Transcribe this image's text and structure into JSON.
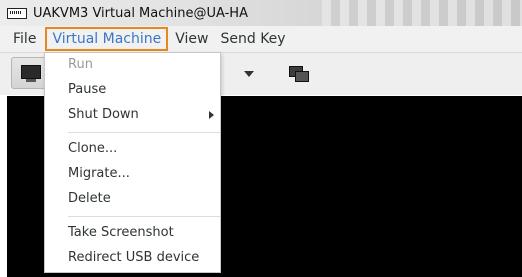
{
  "window": {
    "title": "UAKVM3 Virtual Machine@UA-HA"
  },
  "menubar": {
    "items": [
      "File",
      "Virtual Machine",
      "View",
      "Send Key"
    ],
    "active_item": "Virtual Machine"
  },
  "vm_menu": {
    "items": [
      {
        "label": "Run",
        "enabled": false
      },
      {
        "label": "Pause",
        "enabled": true
      },
      {
        "label": "Shut Down",
        "enabled": true,
        "has_submenu": true
      },
      {
        "label": "Clone...",
        "enabled": true
      },
      {
        "label": "Migrate...",
        "enabled": true
      },
      {
        "label": "Delete",
        "enabled": true
      },
      {
        "label": "Take Screenshot",
        "enabled": true
      },
      {
        "label": "Redirect USB device",
        "enabled": true
      }
    ]
  },
  "toolbar": {
    "icons": [
      "console-monitor-icon",
      "dropdown-arrow-icon",
      "screens-icon"
    ]
  },
  "colors": {
    "active_menu_text": "#3b77c6",
    "active_menu_border": "#e8861f",
    "console_background": "#000000"
  }
}
